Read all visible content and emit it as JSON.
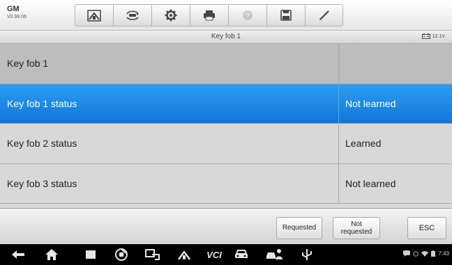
{
  "header": {
    "make": "GM",
    "version": "V0.99.06"
  },
  "toolbar": {
    "items": [
      {
        "icon": "home-icon",
        "enabled": true
      },
      {
        "icon": "vehicle-swap-icon",
        "enabled": true
      },
      {
        "icon": "gear-icon",
        "enabled": true
      },
      {
        "icon": "printer-icon",
        "enabled": true
      },
      {
        "icon": "help-icon",
        "enabled": false
      },
      {
        "icon": "save-icon",
        "enabled": true
      },
      {
        "icon": "pen-icon",
        "enabled": true
      }
    ]
  },
  "titlebar": {
    "title": "Key fob 1",
    "voltage": "12.1V"
  },
  "table": {
    "rows": [
      {
        "name": "Key fob 1",
        "value": ""
      },
      {
        "name": "Key fob 1 status",
        "value": "Not learned"
      },
      {
        "name": "Key fob 2 status",
        "value": "Learned"
      },
      {
        "name": "Key fob 3 status",
        "value": "Not learned"
      }
    ],
    "selected_index": 1
  },
  "actions": {
    "requested": "Requested",
    "not_requested_line1": "Not",
    "not_requested_line2": "requested",
    "esc": "ESC"
  },
  "navbar": {
    "vci_label": "VCI",
    "time": "7:43"
  },
  "colors": {
    "selection": "#1a84e3",
    "navbar": "#000000"
  }
}
